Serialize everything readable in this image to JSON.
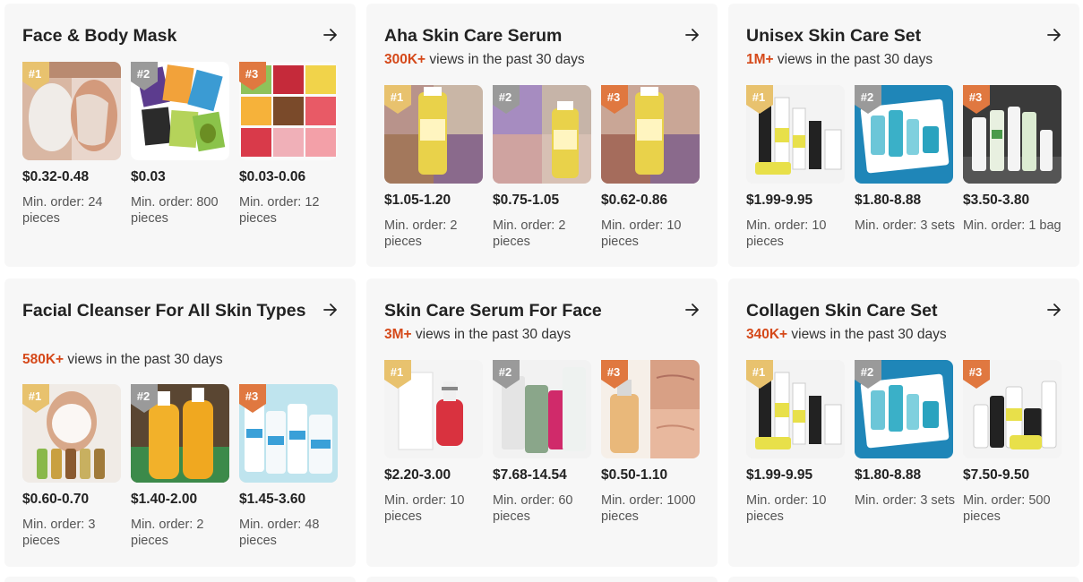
{
  "colors": {
    "accent": "#d5491a",
    "card_bg": "#f7f7f7",
    "rank1": "#e8c26e",
    "rank2": "#9a9a9a",
    "rank3": "#e07840"
  },
  "cards": [
    {
      "title": "Face & Body Mask",
      "views_value": "",
      "views_text": "",
      "products": [
        {
          "rank": "#1",
          "price": "$0.32-0.48",
          "moq": "Min. order: 24 pieces"
        },
        {
          "rank": "#2",
          "price": "$0.03",
          "moq": "Min. order: 800 pieces"
        },
        {
          "rank": "#3",
          "price": "$0.03-0.06",
          "moq": "Min. order: 12 pieces"
        }
      ]
    },
    {
      "title": "Aha Skin Care Serum",
      "views_value": "300K+",
      "views_text": " views in the past 30 days",
      "products": [
        {
          "rank": "#1",
          "price": "$1.05-1.20",
          "moq": "Min. order: 2 pieces"
        },
        {
          "rank": "#2",
          "price": "$0.75-1.05",
          "moq": "Min. order: 2 pieces"
        },
        {
          "rank": "#3",
          "price": "$0.62-0.86",
          "moq": "Min. order: 10 pieces"
        }
      ]
    },
    {
      "title": "Unisex Skin Care Set",
      "views_value": "1M+",
      "views_text": " views in the past 30 days",
      "products": [
        {
          "rank": "#1",
          "price": "$1.99-9.95",
          "moq": "Min. order: 10 pieces"
        },
        {
          "rank": "#2",
          "price": "$1.80-8.88",
          "moq": "Min. order: 3 sets"
        },
        {
          "rank": "#3",
          "price": "$3.50-3.80",
          "moq": "Min. order: 1 bag"
        }
      ]
    },
    {
      "title": "Facial Cleanser For All Skin Types",
      "views_value": "580K+",
      "views_text": " views in the past 30 days",
      "products": [
        {
          "rank": "#1",
          "price": "$0.60-0.70",
          "moq": "Min. order: 3 pieces"
        },
        {
          "rank": "#2",
          "price": "$1.40-2.00",
          "moq": "Min. order: 2 pieces"
        },
        {
          "rank": "#3",
          "price": "$1.45-3.60",
          "moq": "Min. order: 48 pieces"
        }
      ]
    },
    {
      "title": "Skin Care Serum For Face",
      "views_value": "3M+",
      "views_text": " views in the past 30 days",
      "products": [
        {
          "rank": "#1",
          "price": "$2.20-3.00",
          "moq": "Min. order: 10 pieces"
        },
        {
          "rank": "#2",
          "price": "$7.68-14.54",
          "moq": "Min. order: 60 pieces"
        },
        {
          "rank": "#3",
          "price": "$0.50-1.10",
          "moq": "Min. order: 1000 pieces"
        }
      ]
    },
    {
      "title": "Collagen Skin Care Set",
      "views_value": "340K+",
      "views_text": " views in the past 30 days",
      "products": [
        {
          "rank": "#1",
          "price": "$1.99-9.95",
          "moq": "Min. order: 10 pieces"
        },
        {
          "rank": "#2",
          "price": "$1.80-8.88",
          "moq": "Min. order: 3 sets"
        },
        {
          "rank": "#3",
          "price": "$7.50-9.50",
          "moq": "Min. order: 500 pieces"
        }
      ]
    }
  ]
}
